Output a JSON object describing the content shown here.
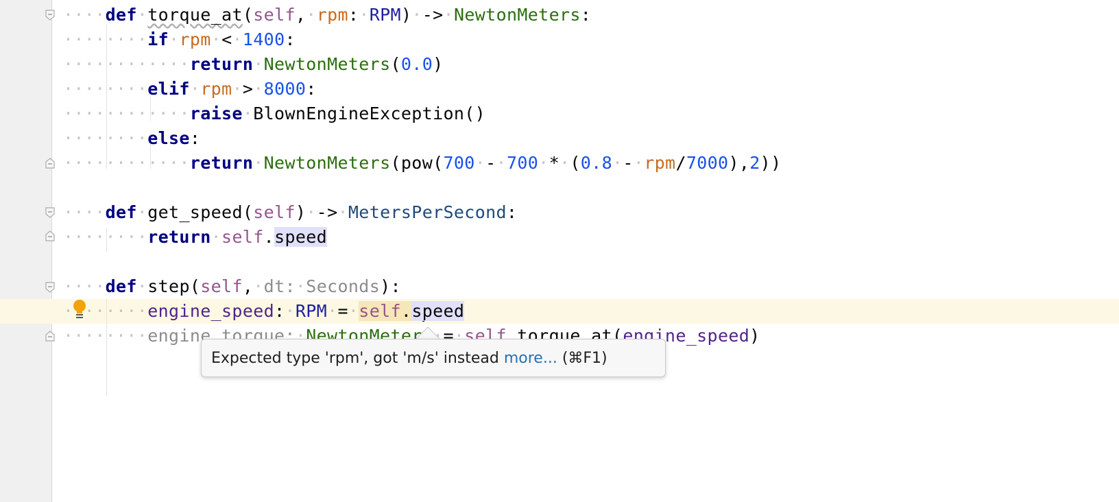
{
  "editor": {
    "lines": [
      {
        "segments": [
          [
            "ws",
            "····"
          ],
          [
            "kw",
            "def"
          ],
          [
            "ws",
            "·"
          ],
          [
            "squiggle",
            "torque_at"
          ],
          [
            "plain",
            "("
          ],
          [
            "self",
            "self"
          ],
          [
            "plain",
            ","
          ],
          [
            "ws",
            "·"
          ],
          [
            "param",
            "rpm"
          ],
          [
            "plain",
            ":"
          ],
          [
            "ws",
            "·"
          ],
          [
            "cls",
            "RPM"
          ],
          [
            "plain",
            ")"
          ],
          [
            "ws",
            "·"
          ],
          [
            "plain",
            "->"
          ],
          [
            "ws",
            "·"
          ],
          [
            "type-green",
            "NewtonMeters"
          ],
          [
            "plain",
            ":"
          ]
        ]
      },
      {
        "segments": [
          [
            "ws",
            "········"
          ],
          [
            "kw",
            "if"
          ],
          [
            "ws",
            "·"
          ],
          [
            "param",
            "rpm"
          ],
          [
            "ws",
            "·"
          ],
          [
            "plain",
            "<"
          ],
          [
            "ws",
            "·"
          ],
          [
            "num",
            "1400"
          ],
          [
            "plain",
            ":"
          ]
        ]
      },
      {
        "segments": [
          [
            "ws",
            "············"
          ],
          [
            "kw",
            "return"
          ],
          [
            "ws",
            "·"
          ],
          [
            "type-green",
            "NewtonMeters"
          ],
          [
            "plain",
            "("
          ],
          [
            "num",
            "0.0"
          ],
          [
            "plain",
            ")"
          ]
        ]
      },
      {
        "segments": [
          [
            "ws",
            "········"
          ],
          [
            "kw",
            "elif"
          ],
          [
            "ws",
            "·"
          ],
          [
            "param",
            "rpm"
          ],
          [
            "ws",
            "·"
          ],
          [
            "plain",
            ">"
          ],
          [
            "ws",
            "·"
          ],
          [
            "num",
            "8000"
          ],
          [
            "plain",
            ":"
          ]
        ]
      },
      {
        "segments": [
          [
            "ws",
            "············"
          ],
          [
            "kw",
            "raise"
          ],
          [
            "ws",
            "·"
          ],
          [
            "plain",
            "BlownEngineException()"
          ]
        ]
      },
      {
        "segments": [
          [
            "ws",
            "········"
          ],
          [
            "kw",
            "else"
          ],
          [
            "plain",
            ":"
          ]
        ]
      },
      {
        "segments": [
          [
            "ws",
            "············"
          ],
          [
            "kw",
            "return"
          ],
          [
            "ws",
            "·"
          ],
          [
            "type-green",
            "NewtonMeters"
          ],
          [
            "plain",
            "(pow("
          ],
          [
            "num",
            "700"
          ],
          [
            "ws",
            "·"
          ],
          [
            "plain",
            "-"
          ],
          [
            "ws",
            "·"
          ],
          [
            "num",
            "700"
          ],
          [
            "ws",
            "·"
          ],
          [
            "plain",
            "*"
          ],
          [
            "ws",
            "·"
          ],
          [
            "plain",
            "("
          ],
          [
            "num",
            "0.8"
          ],
          [
            "ws",
            "·"
          ],
          [
            "plain",
            "-"
          ],
          [
            "ws",
            "·"
          ],
          [
            "param",
            "rpm"
          ],
          [
            "plain",
            "/"
          ],
          [
            "num",
            "7000"
          ],
          [
            "plain",
            "),"
          ],
          [
            "num",
            "2"
          ],
          [
            "plain",
            "))"
          ]
        ]
      },
      {
        "segments": []
      },
      {
        "segments": [
          [
            "ws",
            "····"
          ],
          [
            "kw",
            "def"
          ],
          [
            "ws",
            "·"
          ],
          [
            "plain",
            "get_speed("
          ],
          [
            "self",
            "self"
          ],
          [
            "plain",
            ")"
          ],
          [
            "ws",
            "·"
          ],
          [
            "plain",
            "->"
          ],
          [
            "ws",
            "·"
          ],
          [
            "type-blue",
            "MetersPerSecond"
          ],
          [
            "plain",
            ":"
          ]
        ]
      },
      {
        "segments": [
          [
            "ws",
            "········"
          ],
          [
            "kw",
            "return"
          ],
          [
            "ws",
            "·"
          ],
          [
            "self",
            "self"
          ],
          [
            "plain",
            "."
          ],
          [
            "hl-read",
            "speed"
          ]
        ]
      },
      {
        "segments": []
      },
      {
        "segments": [
          [
            "ws",
            "····"
          ],
          [
            "kw",
            "def"
          ],
          [
            "ws",
            "·"
          ],
          [
            "plain",
            "step("
          ],
          [
            "self",
            "self"
          ],
          [
            "plain",
            ","
          ],
          [
            "ws",
            "·"
          ],
          [
            "gray",
            "dt:"
          ],
          [
            "ws",
            "·"
          ],
          [
            "gray",
            "Seconds"
          ],
          [
            "plain",
            "):"
          ]
        ]
      },
      {
        "segments": [
          [
            "ws",
            "········"
          ],
          [
            "purple",
            "engine_speed"
          ],
          [
            "plain",
            ":"
          ],
          [
            "ws",
            "·"
          ],
          [
            "cls",
            "RPM"
          ],
          [
            "ws",
            "·"
          ],
          [
            "plain",
            "="
          ],
          [
            "ws",
            "·"
          ],
          [
            "hl-self-self",
            "self"
          ],
          [
            "hl-self",
            "."
          ],
          [
            "hl-read",
            "s"
          ],
          [
            "caret",
            ""
          ],
          [
            "hl-read",
            "peed"
          ]
        ]
      },
      {
        "segments": [
          [
            "ws",
            "········"
          ],
          [
            "gray",
            "engine_torque:"
          ],
          [
            "ws",
            "·"
          ],
          [
            "type-green",
            "NewtonMeters"
          ],
          [
            "ws",
            "·"
          ],
          [
            "plain",
            "="
          ],
          [
            "ws",
            "·"
          ],
          [
            "self",
            "self"
          ],
          [
            "plain",
            ".torque_at("
          ],
          [
            "purple",
            "engine_speed"
          ],
          [
            "plain",
            ")"
          ]
        ]
      }
    ]
  },
  "tooltip": {
    "message": "Expected type 'rpm', got 'm/s' instead ",
    "link": "more...",
    "shortcut": " (⌘F1)"
  },
  "icons": {
    "intention": "lightbulb-icon",
    "fold": "fold-marker-icon"
  },
  "colors": {
    "keyword": "#000080",
    "parameter": "#c76b20",
    "self": "#94558d",
    "number": "#1750eb",
    "type": "#2c6e0f",
    "current_line": "#fcf8e3",
    "bulb": "#f0a30a"
  }
}
